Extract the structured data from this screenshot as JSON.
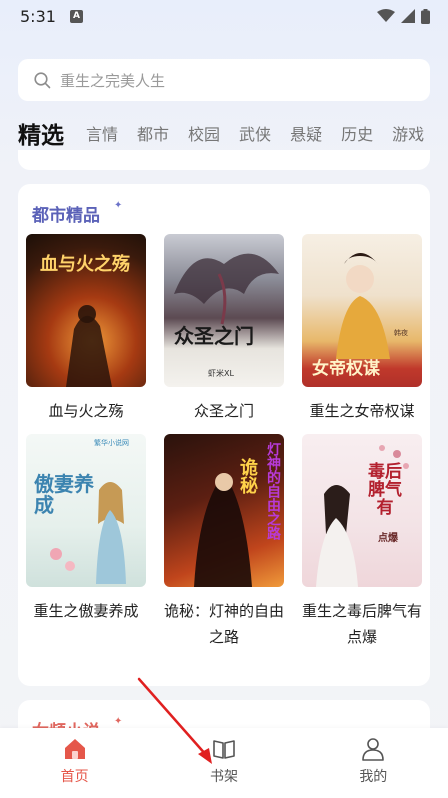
{
  "status_bar": {
    "time": "5:31",
    "notification_badge": "A"
  },
  "search": {
    "placeholder": "重生之完美人生"
  },
  "tabs": [
    {
      "label": "精选",
      "active": true
    },
    {
      "label": "言情"
    },
    {
      "label": "都市"
    },
    {
      "label": "校园"
    },
    {
      "label": "武侠"
    },
    {
      "label": "悬疑"
    },
    {
      "label": "历史"
    },
    {
      "label": "游戏"
    }
  ],
  "section": {
    "title": "都市精品",
    "books": [
      {
        "title": "血与火之殇",
        "cover_text": "血与火之殇"
      },
      {
        "title": "众圣之门",
        "cover_text": "众圣之门",
        "cover_sub": "虾米XL"
      },
      {
        "title": "重生之女帝权谋",
        "cover_text": "女帝权谋",
        "cover_sub": "韩夜"
      },
      {
        "title": "重生之傲妻养成",
        "cover_text": "傲妻养成",
        "cover_sub": "繁华小说网"
      },
      {
        "title": "诡秘：灯神的自由之路",
        "cover_text": "诡秘",
        "cover_text2": "灯神的自由之路"
      },
      {
        "title": "重生之毒后脾气有点爆",
        "cover_text": "毒后脾气有",
        "cover_sub": "点爆"
      }
    ]
  },
  "next_section": {
    "title": "女频小说"
  },
  "bottom_nav": [
    {
      "label": "首页",
      "active": true
    },
    {
      "label": "书架"
    },
    {
      "label": "我的"
    }
  ],
  "colors": {
    "accent": "#e5574a",
    "section_title": "#5b62b8"
  }
}
